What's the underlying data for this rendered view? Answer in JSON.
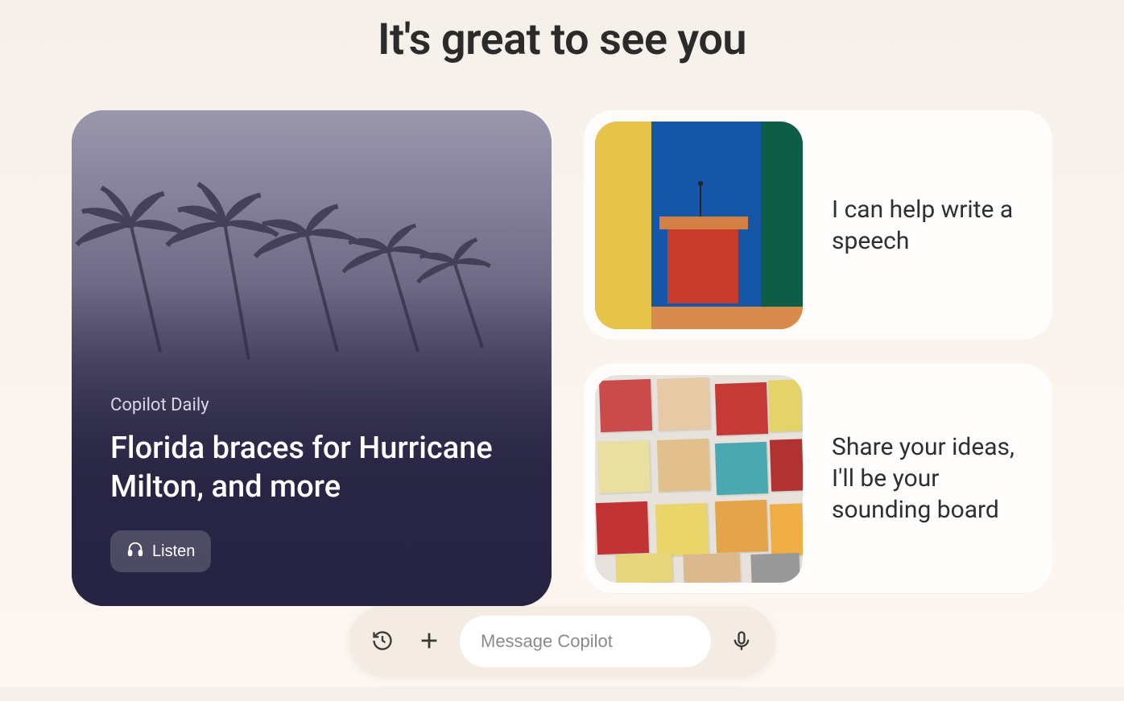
{
  "greeting": "It's great to see you",
  "hero": {
    "eyebrow": "Copilot Daily",
    "headline": "Florida braces for Hurricane Milton, and more",
    "listen_label": "Listen"
  },
  "suggestions": [
    {
      "text": "I can help write a speech",
      "thumb": "podium"
    },
    {
      "text": "Share your ideas, I'll be your sounding board",
      "thumb": "notes"
    }
  ],
  "input": {
    "placeholder": "Message Copilot"
  }
}
